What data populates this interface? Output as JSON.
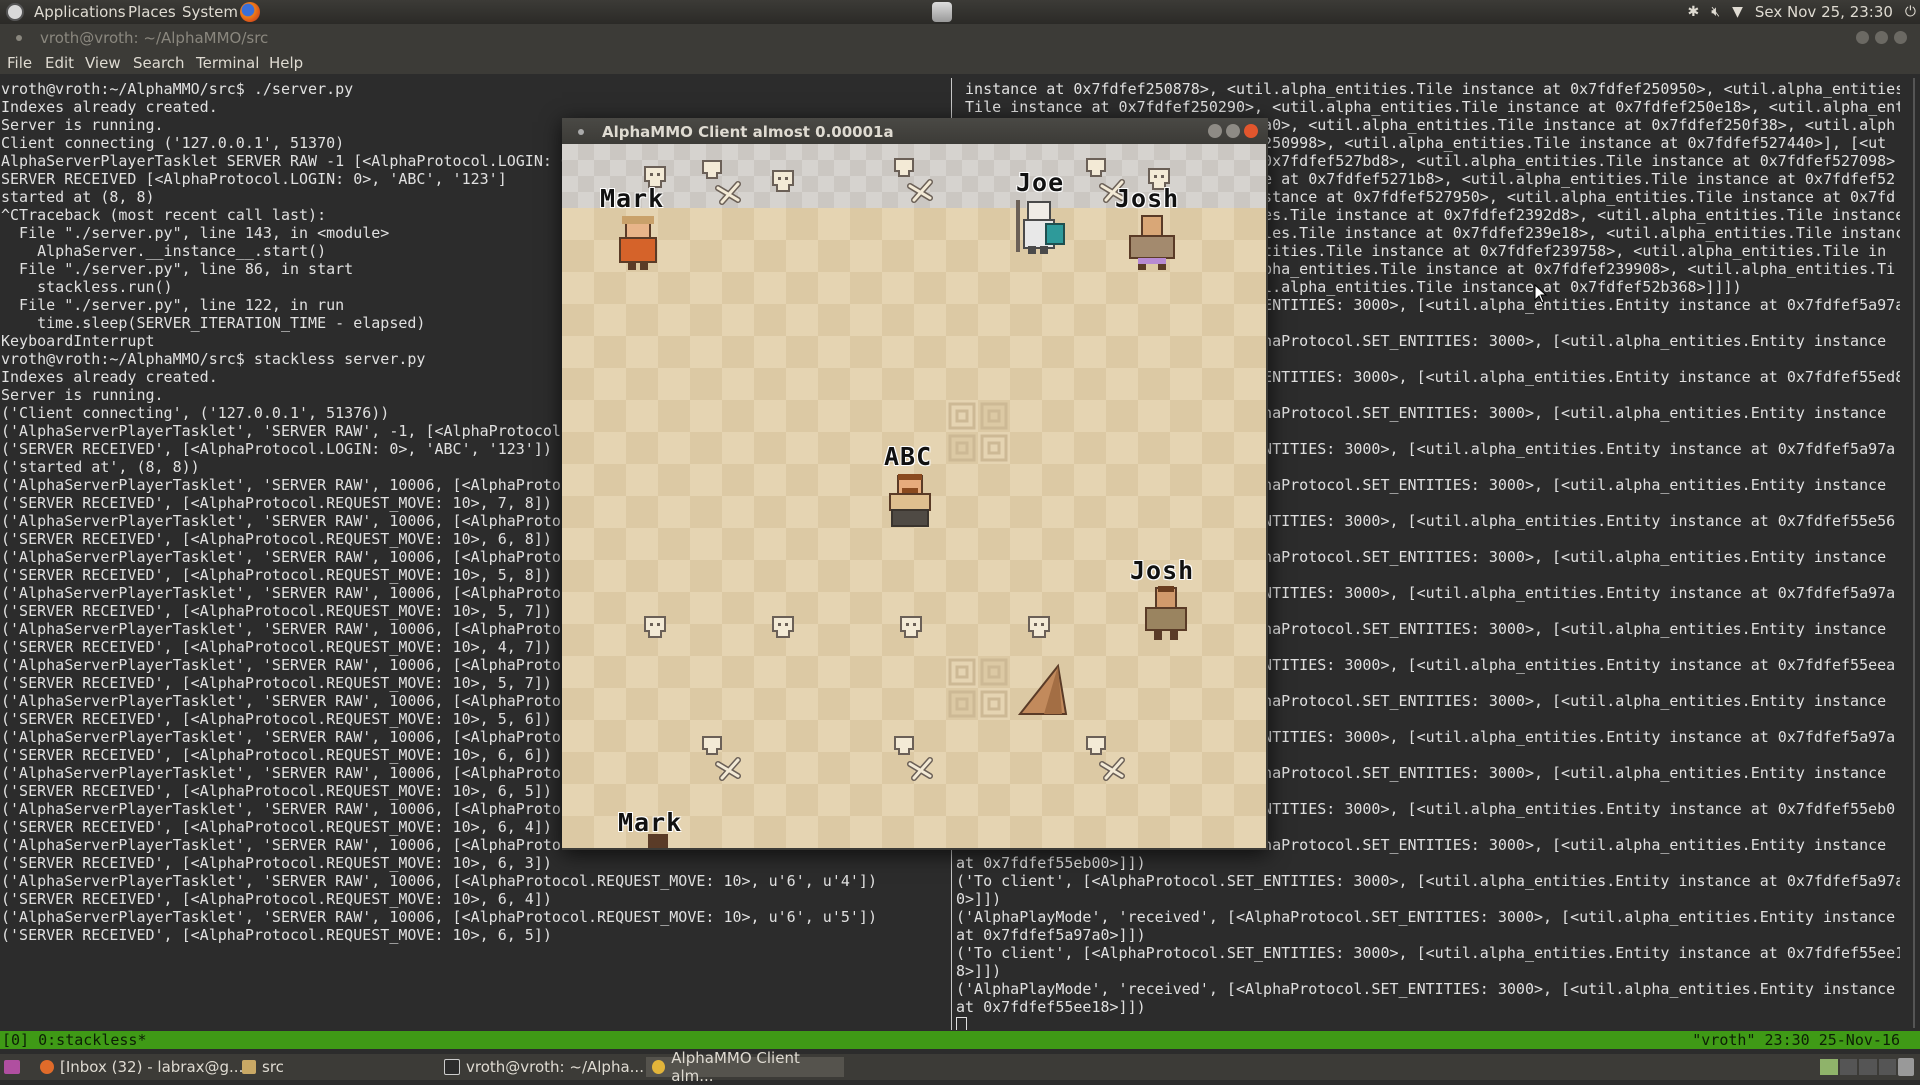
{
  "top_panel": {
    "menus": [
      "Applications",
      "Places",
      "System"
    ],
    "datetime": "Sex Nov 25, 23:30",
    "icons": [
      "ubuntu-logo-icon",
      "firefox-icon",
      "network-drive-icon",
      "bluetooth-icon",
      "volume-muted-icon",
      "wifi-icon",
      "power-icon"
    ]
  },
  "terminal": {
    "title": "vroth@vroth: ~/AlphaMMO/src",
    "menu": [
      "File",
      "Edit",
      "View",
      "Search",
      "Terminal",
      "Help"
    ],
    "left_lines": [
      "vroth@vroth:~/AlphaMMO/src$ ./server.py",
      "Indexes already created.",
      "Server is running.",
      "Client connecting ('127.0.0.1', 51370)",
      "AlphaServerPlayerTasklet SERVER RAW -1 [<AlphaProtocol.LOGIN: 0>",
      "SERVER RECEIVED [<AlphaProtocol.LOGIN: 0>, 'ABC', '123']",
      "started at (8, 8)",
      "^CTraceback (most recent call last):",
      "  File \"./server.py\", line 143, in <module>",
      "    AlphaServer.__instance__.start()",
      "  File \"./server.py\", line 86, in start",
      "    stackless.run()",
      "  File \"./server.py\", line 122, in run",
      "    time.sleep(SERVER_ITERATION_TIME - elapsed)",
      "KeyboardInterrupt",
      "vroth@vroth:~/AlphaMMO/src$ stackless server.py",
      "Indexes already created.",
      "Server is running.",
      "('Client connecting', ('127.0.0.1', 51376))",
      "('AlphaServerPlayerTasklet', 'SERVER RAW', -1, [<AlphaProtocol",
      "('SERVER RECEIVED', [<AlphaProtocol.LOGIN: 0>, 'ABC', '123'])",
      "('started at', (8, 8))",
      "('AlphaServerPlayerTasklet', 'SERVER RAW', 10006, [<AlphaProto",
      "('SERVER RECEIVED', [<AlphaProtocol.REQUEST_MOVE: 10>, 7, 8])",
      "('AlphaServerPlayerTasklet', 'SERVER RAW', 10006, [<AlphaProto",
      "('SERVER RECEIVED', [<AlphaProtocol.REQUEST_MOVE: 10>, 6, 8])",
      "('AlphaServerPlayerTasklet', 'SERVER RAW', 10006, [<AlphaProto",
      "('SERVER RECEIVED', [<AlphaProtocol.REQUEST_MOVE: 10>, 5, 8])",
      "('AlphaServerPlayerTasklet', 'SERVER RAW', 10006, [<AlphaProto",
      "('SERVER RECEIVED', [<AlphaProtocol.REQUEST_MOVE: 10>, 5, 7])",
      "('AlphaServerPlayerTasklet', 'SERVER RAW', 10006, [<AlphaProto",
      "('SERVER RECEIVED', [<AlphaProtocol.REQUEST_MOVE: 10>, 4, 7])",
      "('AlphaServerPlayerTasklet', 'SERVER RAW', 10006, [<AlphaProto",
      "('SERVER RECEIVED', [<AlphaProtocol.REQUEST_MOVE: 10>, 5, 7])",
      "('AlphaServerPlayerTasklet', 'SERVER RAW', 10006, [<AlphaProto",
      "('SERVER RECEIVED', [<AlphaProtocol.REQUEST_MOVE: 10>, 5, 6])",
      "('AlphaServerPlayerTasklet', 'SERVER RAW', 10006, [<AlphaProto",
      "('SERVER RECEIVED', [<AlphaProtocol.REQUEST_MOVE: 10>, 6, 6])",
      "('AlphaServerPlayerTasklet', 'SERVER RAW', 10006, [<AlphaProto",
      "('SERVER RECEIVED', [<AlphaProtocol.REQUEST_MOVE: 10>, 6, 5])",
      "('AlphaServerPlayerTasklet', 'SERVER RAW', 10006, [<AlphaProto",
      "('SERVER RECEIVED', [<AlphaProtocol.REQUEST_MOVE: 10>, 6, 4])",
      "('AlphaServerPlayerTasklet', 'SERVER RAW', 10006, [<AlphaProto",
      "('SERVER RECEIVED', [<AlphaProtocol.REQUEST_MOVE: 10>, 6, 3])",
      "('AlphaServerPlayerTasklet', 'SERVER RAW', 10006, [<AlphaProtocol.REQUEST_MOVE: 10>, u'6', u'4'])",
      "('SERVER RECEIVED', [<AlphaProtocol.REQUEST_MOVE: 10>, 6, 4])",
      "('AlphaServerPlayerTasklet', 'SERVER RAW', 10006, [<AlphaProtocol.REQUEST_MOVE: 10>, u'6', u'5'])",
      "('SERVER RECEIVED', [<AlphaProtocol.REQUEST_MOVE: 10>, 6, 5])"
    ],
    "right_lines": [
      " instance at 0x7fdfef250878>, <util.alpha_entities.Tile instance at 0x7fdfef250950>, <util.alpha_entities",
      " Tile instance at 0x7fdfef250290>, <util.alpha_entities.Tile instance at 0x7fdfef250e18>, <util.alpha_ent",
      "                                  a0>, <util.alpha_entities.Tile instance at 0x7fdfef250f38>, <util.alph",
      "                                  250998>, <util.alpha_entities.Tile instance at 0x7fdfef527440>], [<ut",
      "                                  0x7fdfef527bd8>, <util.alpha_entities.Tile instance at 0x7fdfef527098>",
      "                                  e at 0x7fdfef5271b8>, <util.alpha_entities.Tile instance at 0x7fdfef52",
      "                                  stance at 0x7fdfef527950>, <util.alpha_entities.Tile instance at 0x7fd",
      "                                  es.Tile instance at 0x7fdfef2392d8>, <util.alpha_entities.Tile instance at",
      "                                  les.Tile instance at 0x7fdfef239e18>, <util.alpha_entities.Tile instanc",
      "                                  tities.Tile instance at 0x7fdfef239758>, <util.alpha_entities.Tile in",
      "                                  pha_entities.Tile instance at 0x7fdfef239908>, <util.alpha_entities.Ti",
      "                                  l.alpha_entities.Tile instance at 0x7fdfef52b368>]]])",
      "                                  ENTITIES: 3000>, [<util.alpha_entities.Entity instance at 0x7fdfef5a97a",
      "",
      "                                  haProtocol.SET_ENTITIES: 3000>, [<util.alpha_entities.Entity instance",
      "",
      "                                  ENTITIES: 3000>, [<util.alpha_entities.Entity instance at 0x7fdfef55ed8",
      "",
      "                                  haProtocol.SET_ENTITIES: 3000>, [<util.alpha_entities.Entity instance",
      "",
      "                                  NTITIES: 3000>, [<util.alpha_entities.Entity instance at 0x7fdfef5a97a",
      "",
      "                                  haProtocol.SET_ENTITIES: 3000>, [<util.alpha_entities.Entity instance",
      "",
      "                                  NTITIES: 3000>, [<util.alpha_entities.Entity instance at 0x7fdfef55e56",
      "",
      "                                  haProtocol.SET_ENTITIES: 3000>, [<util.alpha_entities.Entity instance",
      "",
      "                                  NTITIES: 3000>, [<util.alpha_entities.Entity instance at 0x7fdfef5a97a",
      "",
      "                                  haProtocol.SET_ENTITIES: 3000>, [<util.alpha_entities.Entity instance",
      "",
      "                                  NTITIES: 3000>, [<util.alpha_entities.Entity instance at 0x7fdfef55eea",
      "",
      "                                  haProtocol.SET_ENTITIES: 3000>, [<util.alpha_entities.Entity instance",
      "",
      "                                  NTITIES: 3000>, [<util.alpha_entities.Entity instance at 0x7fdfef5a97a",
      "",
      "                                  haProtocol.SET_ENTITIES: 3000>, [<util.alpha_entities.Entity instance",
      "",
      "                                  NTITIES: 3000>, [<util.alpha_entities.Entity instance at 0x7fdfef55eb0",
      "",
      "                                  haProtocol.SET_ENTITIES: 3000>, [<util.alpha_entities.Entity instance",
      "at 0x7fdfef55eb00>]])",
      "('To client', [<AlphaProtocol.SET_ENTITIES: 3000>, [<util.alpha_entities.Entity instance at 0x7fdfef5a97a",
      "0>]])",
      "('AlphaPlayMode', 'received', [<AlphaProtocol.SET_ENTITIES: 3000>, [<util.alpha_entities.Entity instance",
      "at 0x7fdfef5a97a0>]])",
      "('To client', [<AlphaProtocol.SET_ENTITIES: 3000>, [<util.alpha_entities.Entity instance at 0x7fdfef55ee1",
      "8>]])",
      "('AlphaPlayMode', 'received', [<AlphaProtocol.SET_ENTITIES: 3000>, [<util.alpha_entities.Entity instance",
      "at 0x7fdfef55ee18>]])"
    ],
    "tmux_left": "[0] 0:stackless*",
    "tmux_right": "\"vroth\" 23:30 25-Nov-16"
  },
  "game": {
    "title": "AlphaMMO Client almost 0.00001a",
    "names": {
      "mark_top": "Mark",
      "joe": "Joe",
      "josh_top": "Josh",
      "abc": "ABC",
      "josh_mid": "Josh",
      "mark_bottom": "Mark"
    },
    "colors": {
      "floor_light": "#e5d4b2",
      "floor_dark": "#dcc9a4",
      "wall": "#d6d3cf"
    }
  },
  "taskbar": {
    "items": [
      "[Inbox (32) - labrax@g...",
      "src",
      "vroth@vroth: ~/Alpha...",
      "AlphaMMO Client alm..."
    ]
  }
}
